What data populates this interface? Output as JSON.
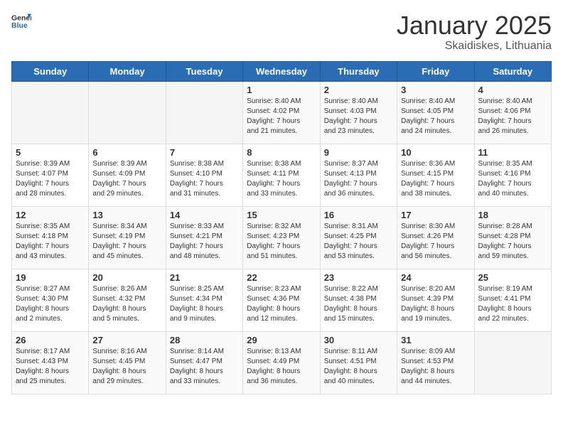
{
  "header": {
    "logo_general": "General",
    "logo_blue": "Blue",
    "title": "January 2025",
    "subtitle": "Skaidiskes, Lithuania"
  },
  "weekdays": [
    "Sunday",
    "Monday",
    "Tuesday",
    "Wednesday",
    "Thursday",
    "Friday",
    "Saturday"
  ],
  "weeks": [
    [
      {
        "day": "",
        "info": ""
      },
      {
        "day": "",
        "info": ""
      },
      {
        "day": "",
        "info": ""
      },
      {
        "day": "1",
        "info": "Sunrise: 8:40 AM\nSunset: 4:02 PM\nDaylight: 7 hours\nand 21 minutes."
      },
      {
        "day": "2",
        "info": "Sunrise: 8:40 AM\nSunset: 4:03 PM\nDaylight: 7 hours\nand 23 minutes."
      },
      {
        "day": "3",
        "info": "Sunrise: 8:40 AM\nSunset: 4:05 PM\nDaylight: 7 hours\nand 24 minutes."
      },
      {
        "day": "4",
        "info": "Sunrise: 8:40 AM\nSunset: 4:06 PM\nDaylight: 7 hours\nand 26 minutes."
      }
    ],
    [
      {
        "day": "5",
        "info": "Sunrise: 8:39 AM\nSunset: 4:07 PM\nDaylight: 7 hours\nand 28 minutes."
      },
      {
        "day": "6",
        "info": "Sunrise: 8:39 AM\nSunset: 4:09 PM\nDaylight: 7 hours\nand 29 minutes."
      },
      {
        "day": "7",
        "info": "Sunrise: 8:38 AM\nSunset: 4:10 PM\nDaylight: 7 hours\nand 31 minutes."
      },
      {
        "day": "8",
        "info": "Sunrise: 8:38 AM\nSunset: 4:11 PM\nDaylight: 7 hours\nand 33 minutes."
      },
      {
        "day": "9",
        "info": "Sunrise: 8:37 AM\nSunset: 4:13 PM\nDaylight: 7 hours\nand 36 minutes."
      },
      {
        "day": "10",
        "info": "Sunrise: 8:36 AM\nSunset: 4:15 PM\nDaylight: 7 hours\nand 38 minutes."
      },
      {
        "day": "11",
        "info": "Sunrise: 8:35 AM\nSunset: 4:16 PM\nDaylight: 7 hours\nand 40 minutes."
      }
    ],
    [
      {
        "day": "12",
        "info": "Sunrise: 8:35 AM\nSunset: 4:18 PM\nDaylight: 7 hours\nand 43 minutes."
      },
      {
        "day": "13",
        "info": "Sunrise: 8:34 AM\nSunset: 4:19 PM\nDaylight: 7 hours\nand 45 minutes."
      },
      {
        "day": "14",
        "info": "Sunrise: 8:33 AM\nSunset: 4:21 PM\nDaylight: 7 hours\nand 48 minutes."
      },
      {
        "day": "15",
        "info": "Sunrise: 8:32 AM\nSunset: 4:23 PM\nDaylight: 7 hours\nand 51 minutes."
      },
      {
        "day": "16",
        "info": "Sunrise: 8:31 AM\nSunset: 4:25 PM\nDaylight: 7 hours\nand 53 minutes."
      },
      {
        "day": "17",
        "info": "Sunrise: 8:30 AM\nSunset: 4:26 PM\nDaylight: 7 hours\nand 56 minutes."
      },
      {
        "day": "18",
        "info": "Sunrise: 8:28 AM\nSunset: 4:28 PM\nDaylight: 7 hours\nand 59 minutes."
      }
    ],
    [
      {
        "day": "19",
        "info": "Sunrise: 8:27 AM\nSunset: 4:30 PM\nDaylight: 8 hours\nand 2 minutes."
      },
      {
        "day": "20",
        "info": "Sunrise: 8:26 AM\nSunset: 4:32 PM\nDaylight: 8 hours\nand 5 minutes."
      },
      {
        "day": "21",
        "info": "Sunrise: 8:25 AM\nSunset: 4:34 PM\nDaylight: 8 hours\nand 9 minutes."
      },
      {
        "day": "22",
        "info": "Sunrise: 8:23 AM\nSunset: 4:36 PM\nDaylight: 8 hours\nand 12 minutes."
      },
      {
        "day": "23",
        "info": "Sunrise: 8:22 AM\nSunset: 4:38 PM\nDaylight: 8 hours\nand 15 minutes."
      },
      {
        "day": "24",
        "info": "Sunrise: 8:20 AM\nSunset: 4:39 PM\nDaylight: 8 hours\nand 19 minutes."
      },
      {
        "day": "25",
        "info": "Sunrise: 8:19 AM\nSunset: 4:41 PM\nDaylight: 8 hours\nand 22 minutes."
      }
    ],
    [
      {
        "day": "26",
        "info": "Sunrise: 8:17 AM\nSunset: 4:43 PM\nDaylight: 8 hours\nand 25 minutes."
      },
      {
        "day": "27",
        "info": "Sunrise: 8:16 AM\nSunset: 4:45 PM\nDaylight: 8 hours\nand 29 minutes."
      },
      {
        "day": "28",
        "info": "Sunrise: 8:14 AM\nSunset: 4:47 PM\nDaylight: 8 hours\nand 33 minutes."
      },
      {
        "day": "29",
        "info": "Sunrise: 8:13 AM\nSunset: 4:49 PM\nDaylight: 8 hours\nand 36 minutes."
      },
      {
        "day": "30",
        "info": "Sunrise: 8:11 AM\nSunset: 4:51 PM\nDaylight: 8 hours\nand 40 minutes."
      },
      {
        "day": "31",
        "info": "Sunrise: 8:09 AM\nSunset: 4:53 PM\nDaylight: 8 hours\nand 44 minutes."
      },
      {
        "day": "",
        "info": ""
      }
    ]
  ]
}
